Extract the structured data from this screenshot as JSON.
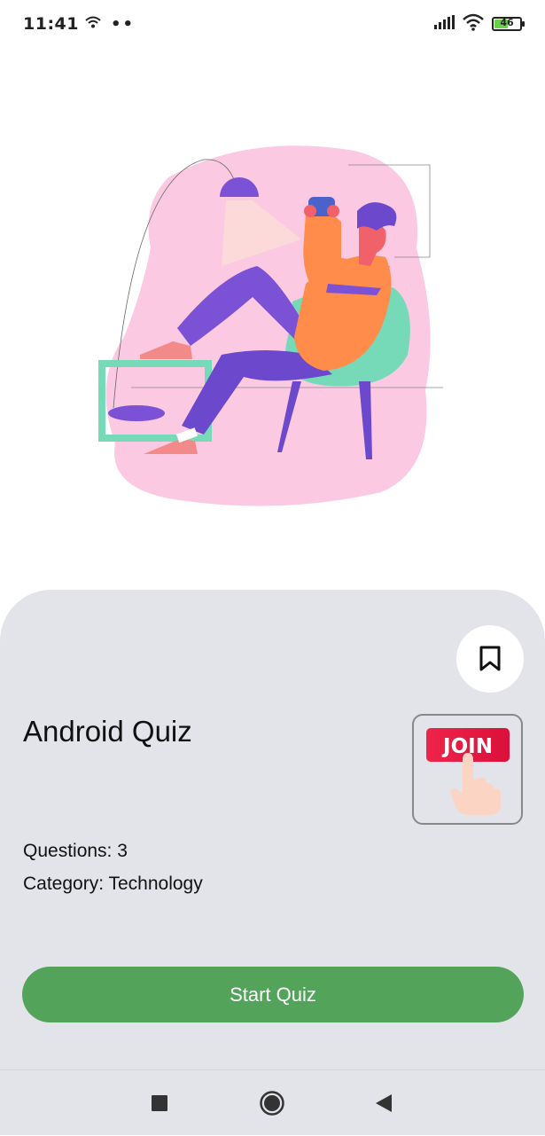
{
  "status_bar": {
    "time": "11:41",
    "battery_level": "46",
    "battery_color": "#6bd04a"
  },
  "quiz": {
    "title": "Android Quiz",
    "questions_text": "Questions: 3",
    "category_text": "Category: Technology",
    "join_badge_text": "JOIN"
  },
  "actions": {
    "start_label": "Start Quiz",
    "bookmark_icon": "bookmark-icon"
  },
  "nav_bar": {
    "recents_icon": "square-icon",
    "home_icon": "circle-icon",
    "back_icon": "triangle-back-icon"
  },
  "colors": {
    "accent_green": "#53a35b",
    "card_background": "#e3e4ea",
    "join_red": "#e8163f"
  }
}
